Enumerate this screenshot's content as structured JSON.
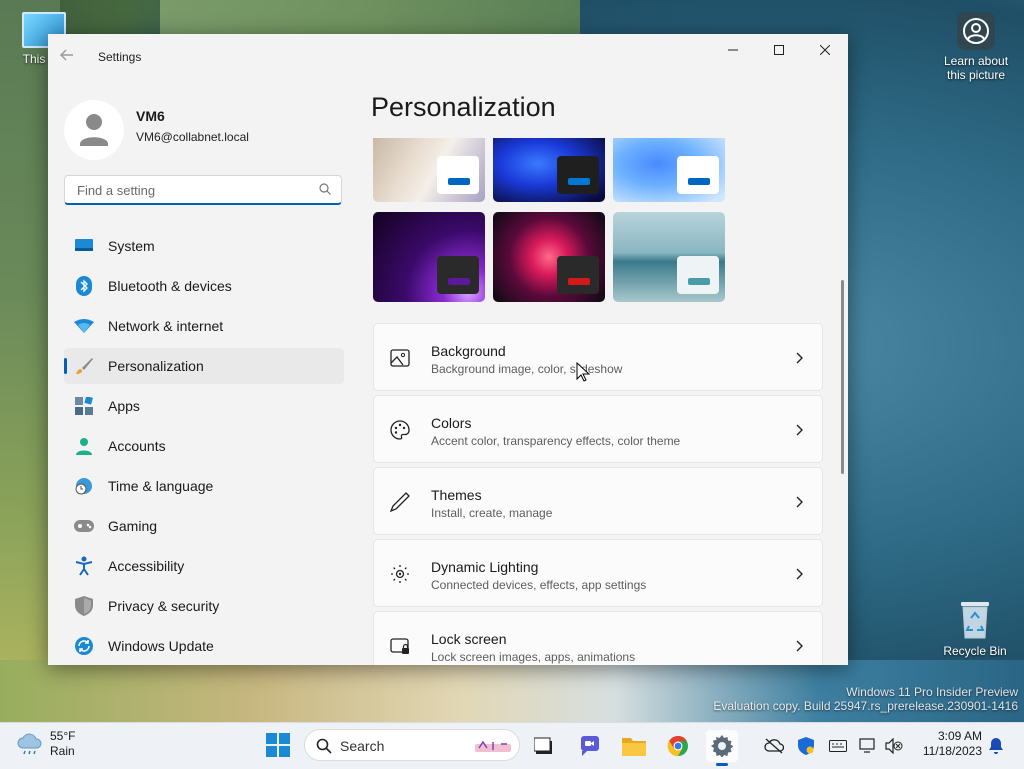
{
  "desktop": {
    "icons": {
      "this_pc": "This PC",
      "learn": "Learn about this picture",
      "recycle_bin": "Recycle Bin"
    },
    "watermark": {
      "line1": "Windows 11 Pro Insider Preview",
      "line2": "Evaluation copy. Build 25947.rs_prerelease.230901-1416"
    }
  },
  "window": {
    "title": "Settings",
    "controls": {
      "minimize": "minimize-icon",
      "maximize": "maximize-icon",
      "close": "close-icon"
    }
  },
  "profile": {
    "name": "VM6",
    "email": "VM6@collabnet.local"
  },
  "search": {
    "placeholder": "Find a setting"
  },
  "nav": {
    "items": [
      {
        "label": "System",
        "icon": "system-icon"
      },
      {
        "label": "Bluetooth & devices",
        "icon": "bluetooth-icon"
      },
      {
        "label": "Network & internet",
        "icon": "wifi-icon"
      },
      {
        "label": "Personalization",
        "icon": "brush-icon",
        "active": true
      },
      {
        "label": "Apps",
        "icon": "apps-icon"
      },
      {
        "label": "Accounts",
        "icon": "account-icon"
      },
      {
        "label": "Time & language",
        "icon": "globe-clock-icon"
      },
      {
        "label": "Gaming",
        "icon": "gamepad-icon"
      },
      {
        "label": "Accessibility",
        "icon": "accessibility-icon"
      },
      {
        "label": "Privacy & security",
        "icon": "shield-icon"
      },
      {
        "label": "Windows Update",
        "icon": "update-icon"
      }
    ]
  },
  "main": {
    "title": "Personalization",
    "theme_chip_colors": [
      "#0067c0",
      "#0078d4",
      "#0067c0",
      "#5a1a9a",
      "#d21a1a",
      "#4a9aa8"
    ],
    "cards": [
      {
        "title": "Background",
        "subtitle": "Background image, color, slideshow",
        "icon": "image-icon"
      },
      {
        "title": "Colors",
        "subtitle": "Accent color, transparency effects, color theme",
        "icon": "palette-icon"
      },
      {
        "title": "Themes",
        "subtitle": "Install, create, manage",
        "icon": "pen-icon"
      },
      {
        "title": "Dynamic Lighting",
        "subtitle": "Connected devices, effects, app settings",
        "icon": "sun-icon"
      },
      {
        "title": "Lock screen",
        "subtitle": "Lock screen images, apps, animations",
        "icon": "lock-screen-icon"
      }
    ]
  },
  "taskbar": {
    "weather": {
      "temp": "55°F",
      "condition": "Rain"
    },
    "search_label": "Search",
    "clock": {
      "time": "3:09 AM",
      "date": "11/18/2023"
    }
  }
}
